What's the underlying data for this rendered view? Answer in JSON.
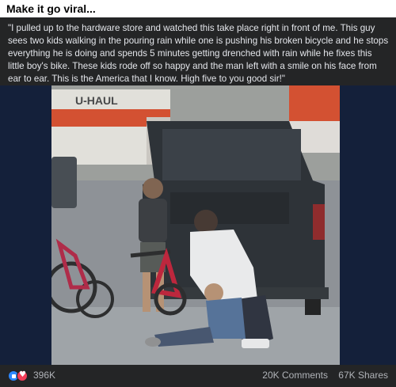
{
  "header": {
    "title": "Make it go viral..."
  },
  "post": {
    "text": "\"I pulled up to the hardware store and watched this take place right in front of me. This guy sees two kids walking in the pouring rain while one is pushing his broken bicycle and he stops everything he is doing and spends 5 minutes getting drenched with rain while he fixes this little boy's bike. These kids rode off so happy and the man left with a smile on his face from ear to ear. This is the America that I know. High five to you good sir!\"",
    "photo": {
      "sign_text": "U-HAUL"
    }
  },
  "stats": {
    "reaction_count": "396K",
    "comments": "20K Comments",
    "shares": "67K Shares"
  },
  "icons": {
    "like": "like-icon",
    "love": "love-icon"
  },
  "colors": {
    "like_blue": "#2d88ff",
    "love_red": "#f33e58",
    "uhaul_orange": "#d9441f"
  }
}
